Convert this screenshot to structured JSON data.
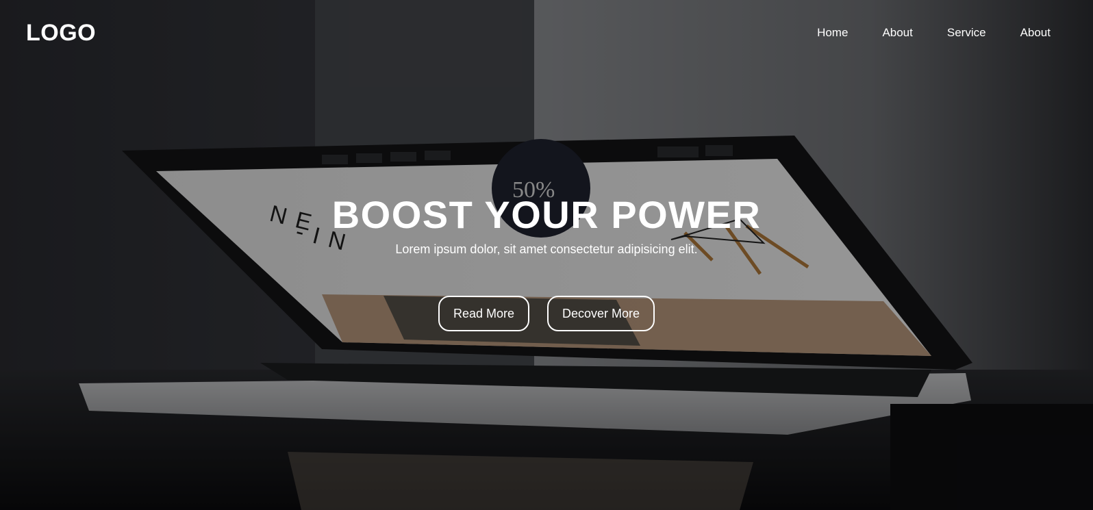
{
  "header": {
    "logo": "LOGO",
    "nav": [
      {
        "label": "Home"
      },
      {
        "label": "About"
      },
      {
        "label": "Service"
      },
      {
        "label": "About"
      }
    ]
  },
  "hero": {
    "title": "BOOST YOUR POWER",
    "subtitle": "Lorem ipsum dolor, sit amet consectetur adipisicing elit.",
    "buttons": [
      {
        "label": "Read More"
      },
      {
        "label": "Decover More"
      }
    ]
  },
  "background_image": {
    "screen_text": [
      "NE",
      "-IN",
      "50%"
    ]
  },
  "colors": {
    "text": "#ffffff",
    "overlay": "#000000",
    "background": "#1b1c20"
  }
}
